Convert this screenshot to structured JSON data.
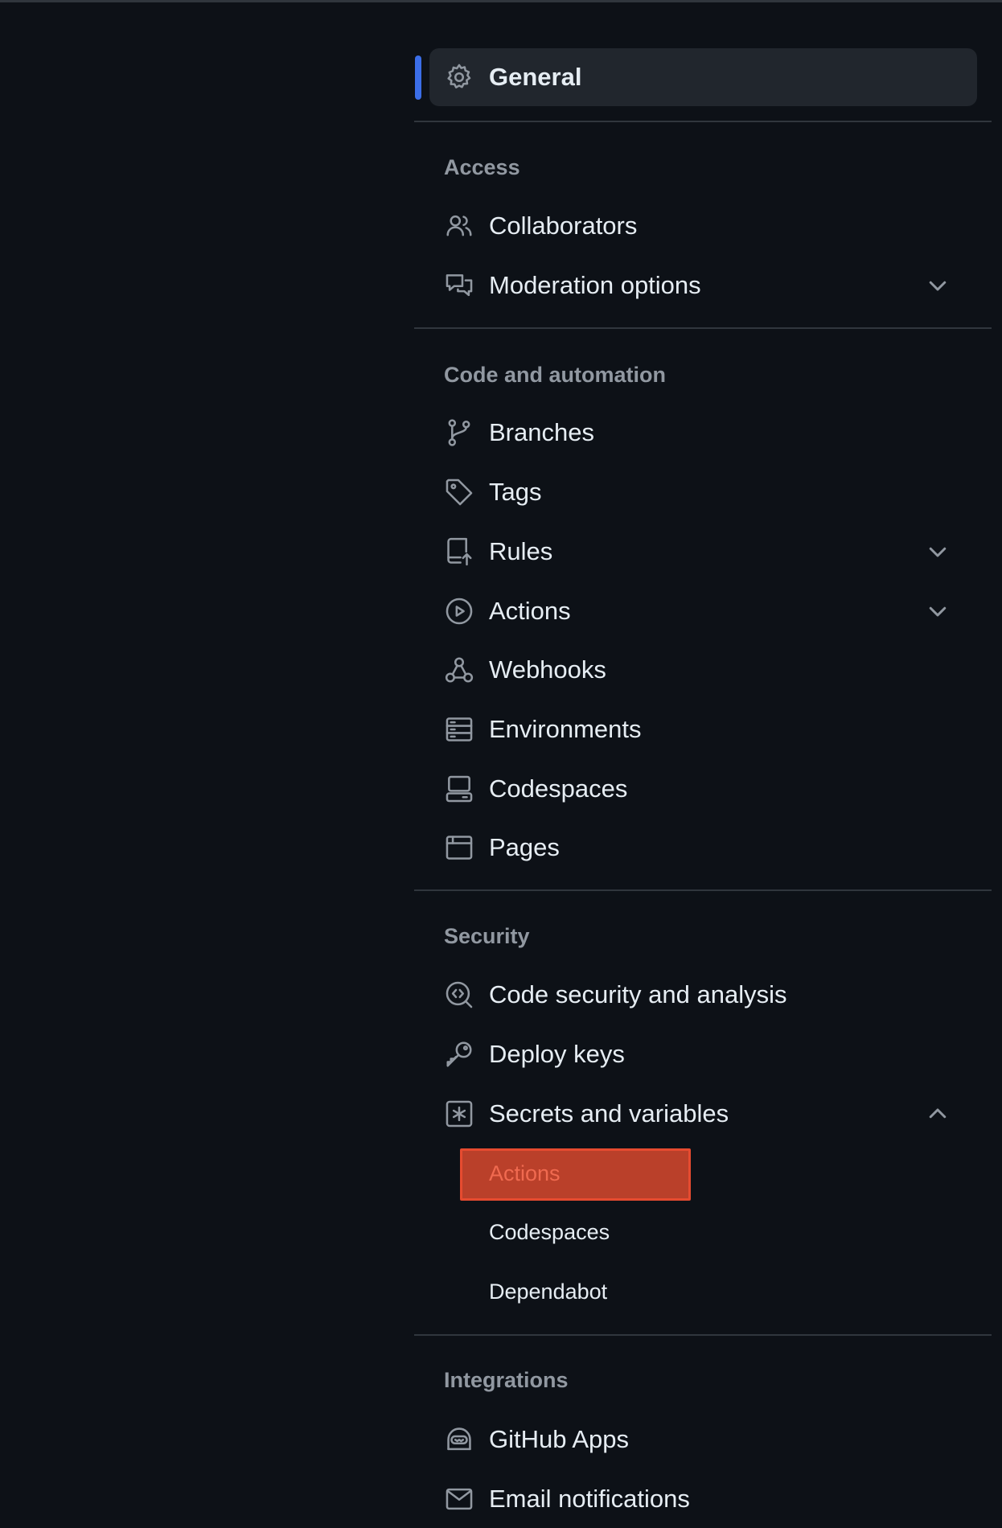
{
  "general": {
    "label": "General",
    "icon": "gear-icon"
  },
  "sections": {
    "access": {
      "title": "Access",
      "items": [
        {
          "label": "Collaborators",
          "icon": "people-icon"
        },
        {
          "label": "Moderation options",
          "icon": "comment-discussion-icon",
          "expanded": false
        }
      ]
    },
    "code": {
      "title": "Code and automation",
      "items": [
        {
          "label": "Branches",
          "icon": "git-branch-icon"
        },
        {
          "label": "Tags",
          "icon": "tag-icon"
        },
        {
          "label": "Rules",
          "icon": "repo-push-icon",
          "expanded": false
        },
        {
          "label": "Actions",
          "icon": "play-icon",
          "expanded": false
        },
        {
          "label": "Webhooks",
          "icon": "webhook-icon"
        },
        {
          "label": "Environments",
          "icon": "server-icon"
        },
        {
          "label": "Codespaces",
          "icon": "codespaces-icon"
        },
        {
          "label": "Pages",
          "icon": "browser-icon"
        }
      ]
    },
    "security": {
      "title": "Security",
      "items": [
        {
          "label": "Code security and analysis",
          "icon": "codescan-icon"
        },
        {
          "label": "Deploy keys",
          "icon": "key-icon"
        },
        {
          "label": "Secrets and variables",
          "icon": "key-asterisk-icon",
          "expanded": true
        }
      ],
      "sub_items": [
        "Actions",
        "Codespaces",
        "Dependabot"
      ]
    },
    "integrations": {
      "title": "Integrations",
      "items": [
        {
          "label": "GitHub Apps",
          "icon": "hubot-icon"
        },
        {
          "label": "Email notifications",
          "icon": "mail-icon"
        }
      ]
    }
  },
  "colors": {
    "background": "#0d1117",
    "active_accent": "#3b6ee8",
    "highlight_fill": "#ba402a",
    "highlight_border": "#e64b30"
  }
}
